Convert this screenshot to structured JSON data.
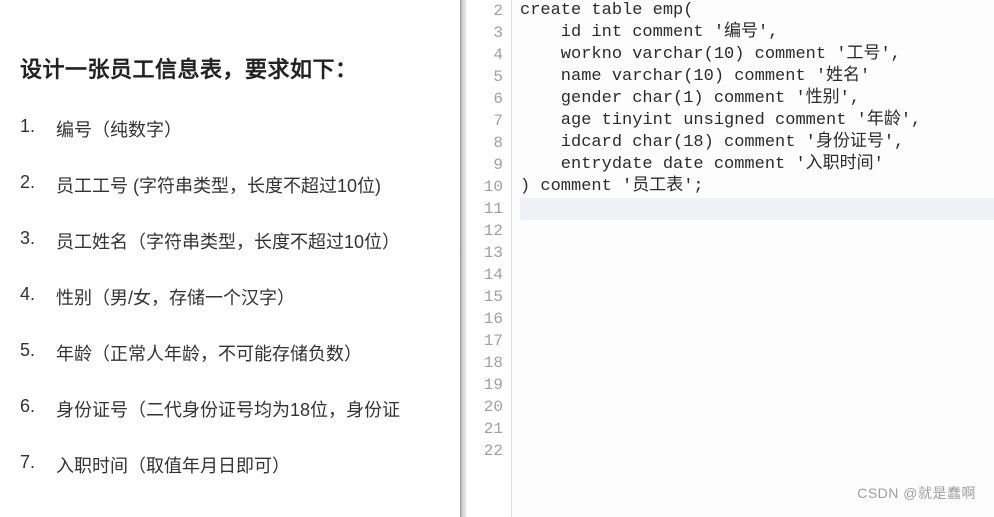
{
  "left": {
    "title": "设计一张员工信息表，要求如下：",
    "items": [
      "编号（纯数字）",
      "员工工号 (字符串类型，长度不超过10位)",
      "员工姓名（字符串类型，长度不超过10位）",
      "性别（男/女，存储一个汉字）",
      "年龄（正常人年龄，不可能存储负数）",
      "身份证号（二代身份证号均为18位，身份证",
      "入职时间（取值年月日即可）"
    ]
  },
  "editor": {
    "first_line_number": 2,
    "lines": [
      "create table emp(",
      "    id int comment '编号',",
      "    workno varchar(10) comment '工号',",
      "    name varchar(10) comment '姓名'",
      "    gender char(1) comment '性别',",
      "    age tinyint unsigned comment '年龄',",
      "    idcard char(18) comment '身份证号',",
      "    entrydate date comment '入职时间'",
      ") comment '员工表';",
      "",
      "",
      "",
      "",
      "",
      "",
      "",
      "",
      "",
      "",
      "",
      ""
    ],
    "highlight_row_index": 9,
    "cursor_row_index": 7,
    "cursor_after_text": "    entrydate date comm"
  },
  "watermark": "CSDN @就是蠢啊"
}
